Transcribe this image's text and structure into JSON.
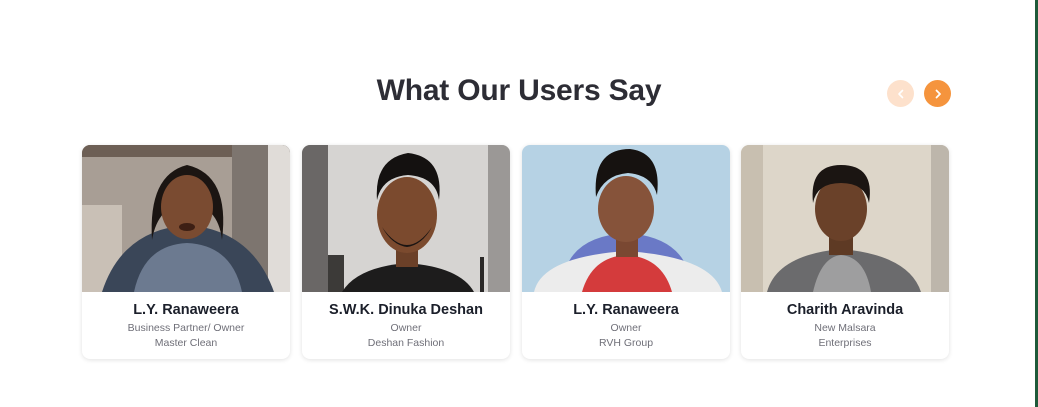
{
  "section": {
    "title": "What Our Users Say"
  },
  "nav": {
    "prev_icon": "chevron-left-icon",
    "next_icon": "chevron-right-icon",
    "accent": "#f5943d",
    "accent_light": "#fde1cc"
  },
  "testimonials": [
    {
      "name": "L.Y. Ranaweera",
      "role": "Business Partner/ Owner",
      "company": "Master Clean"
    },
    {
      "name": "S.W.K. Dinuka Deshan",
      "role": "Owner",
      "company": "Deshan Fashion"
    },
    {
      "name": "L.Y. Ranaweera",
      "role": "Owner",
      "company": "RVH Group"
    },
    {
      "name": "Charith Aravinda",
      "role": "New Malsara",
      "company": "Enterprises"
    }
  ]
}
